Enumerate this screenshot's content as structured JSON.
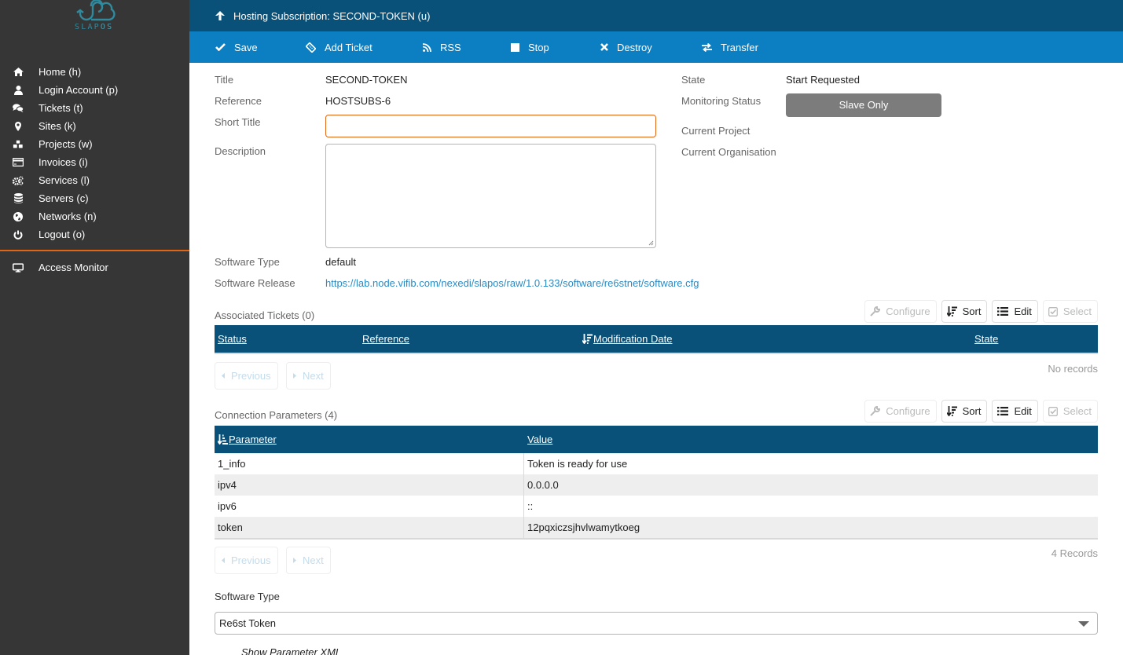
{
  "logo": {
    "text_a": "SLAP",
    "text_b": "OS",
    "color": "#2f8a9e"
  },
  "sidebar": {
    "items": [
      {
        "label": "Home (h)",
        "icon": "home-icon"
      },
      {
        "label": "Login Account (p)",
        "icon": "user-icon"
      },
      {
        "label": "Tickets (t)",
        "icon": "comments-icon"
      },
      {
        "label": "Sites (k)",
        "icon": "map-marker-icon"
      },
      {
        "label": "Projects (w)",
        "icon": "cubes-icon"
      },
      {
        "label": "Invoices (i)",
        "icon": "credit-card-icon"
      },
      {
        "label": "Services (l)",
        "icon": "cogs-icon"
      },
      {
        "label": "Servers (c)",
        "icon": "database-icon"
      },
      {
        "label": "Networks (n)",
        "icon": "globe-icon"
      },
      {
        "label": "Logout (o)",
        "icon": "power-off-icon"
      }
    ],
    "extra": [
      {
        "label": "Access Monitor",
        "icon": "desktop-icon"
      }
    ]
  },
  "header": {
    "title": "Hosting Subscription: SECOND-TOKEN (u)",
    "icon": "arrow-up-icon"
  },
  "actions": [
    {
      "label": "Save",
      "icon": "check-icon"
    },
    {
      "label": "Add Ticket",
      "icon": "ticket-icon"
    },
    {
      "label": "RSS",
      "icon": "rss-icon"
    },
    {
      "label": "Stop",
      "icon": "stop-icon"
    },
    {
      "label": "Destroy",
      "icon": "times-icon"
    },
    {
      "label": "Transfer",
      "icon": "exchange-icon"
    }
  ],
  "form": {
    "title_label": "Title",
    "title_value": "SECOND-TOKEN",
    "reference_label": "Reference",
    "reference_value": "HOSTSUBS-6",
    "short_title_label": "Short Title",
    "short_title_value": "",
    "description_label": "Description",
    "description_value": "",
    "state_label": "State",
    "state_value": "Start Requested",
    "monitoring_label": "Monitoring Status",
    "monitoring_value": "Slave Only",
    "project_label": "Current Project",
    "project_value": "",
    "organisation_label": "Current Organisation",
    "organisation_value": "",
    "software_type_label": "Software Type",
    "software_type_value": "default",
    "software_release_label": "Software Release",
    "software_release_value": "https://lab.node.vifib.com/nexedi/slapos/raw/1.0.133/software/re6stnet/software.cfg"
  },
  "listbox_tools": {
    "configure": "Configure",
    "sort": "Sort",
    "edit": "Edit",
    "select": "Select"
  },
  "tickets": {
    "title": "Associated Tickets (0)",
    "columns": [
      "Status",
      "Reference",
      "Modification Date",
      "State"
    ],
    "rows": [],
    "records": "No records",
    "previous": "Previous",
    "next": "Next"
  },
  "connection": {
    "title": "Connection Parameters (4)",
    "columns": [
      "Parameter",
      "Value"
    ],
    "rows": [
      {
        "parameter": "1_info",
        "value": "Token is ready for use"
      },
      {
        "parameter": "ipv4",
        "value": "0.0.0.0"
      },
      {
        "parameter": "ipv6",
        "value": "::"
      },
      {
        "parameter": "token",
        "value": "12pqxiczsjhvlwamytkoeg"
      }
    ],
    "records": "4 Records",
    "previous": "Previous",
    "next": "Next"
  },
  "instance": {
    "software_type_label": "Software Type",
    "software_type_selected": "Re6st Token",
    "show_xml": "Show Parameter XML"
  }
}
